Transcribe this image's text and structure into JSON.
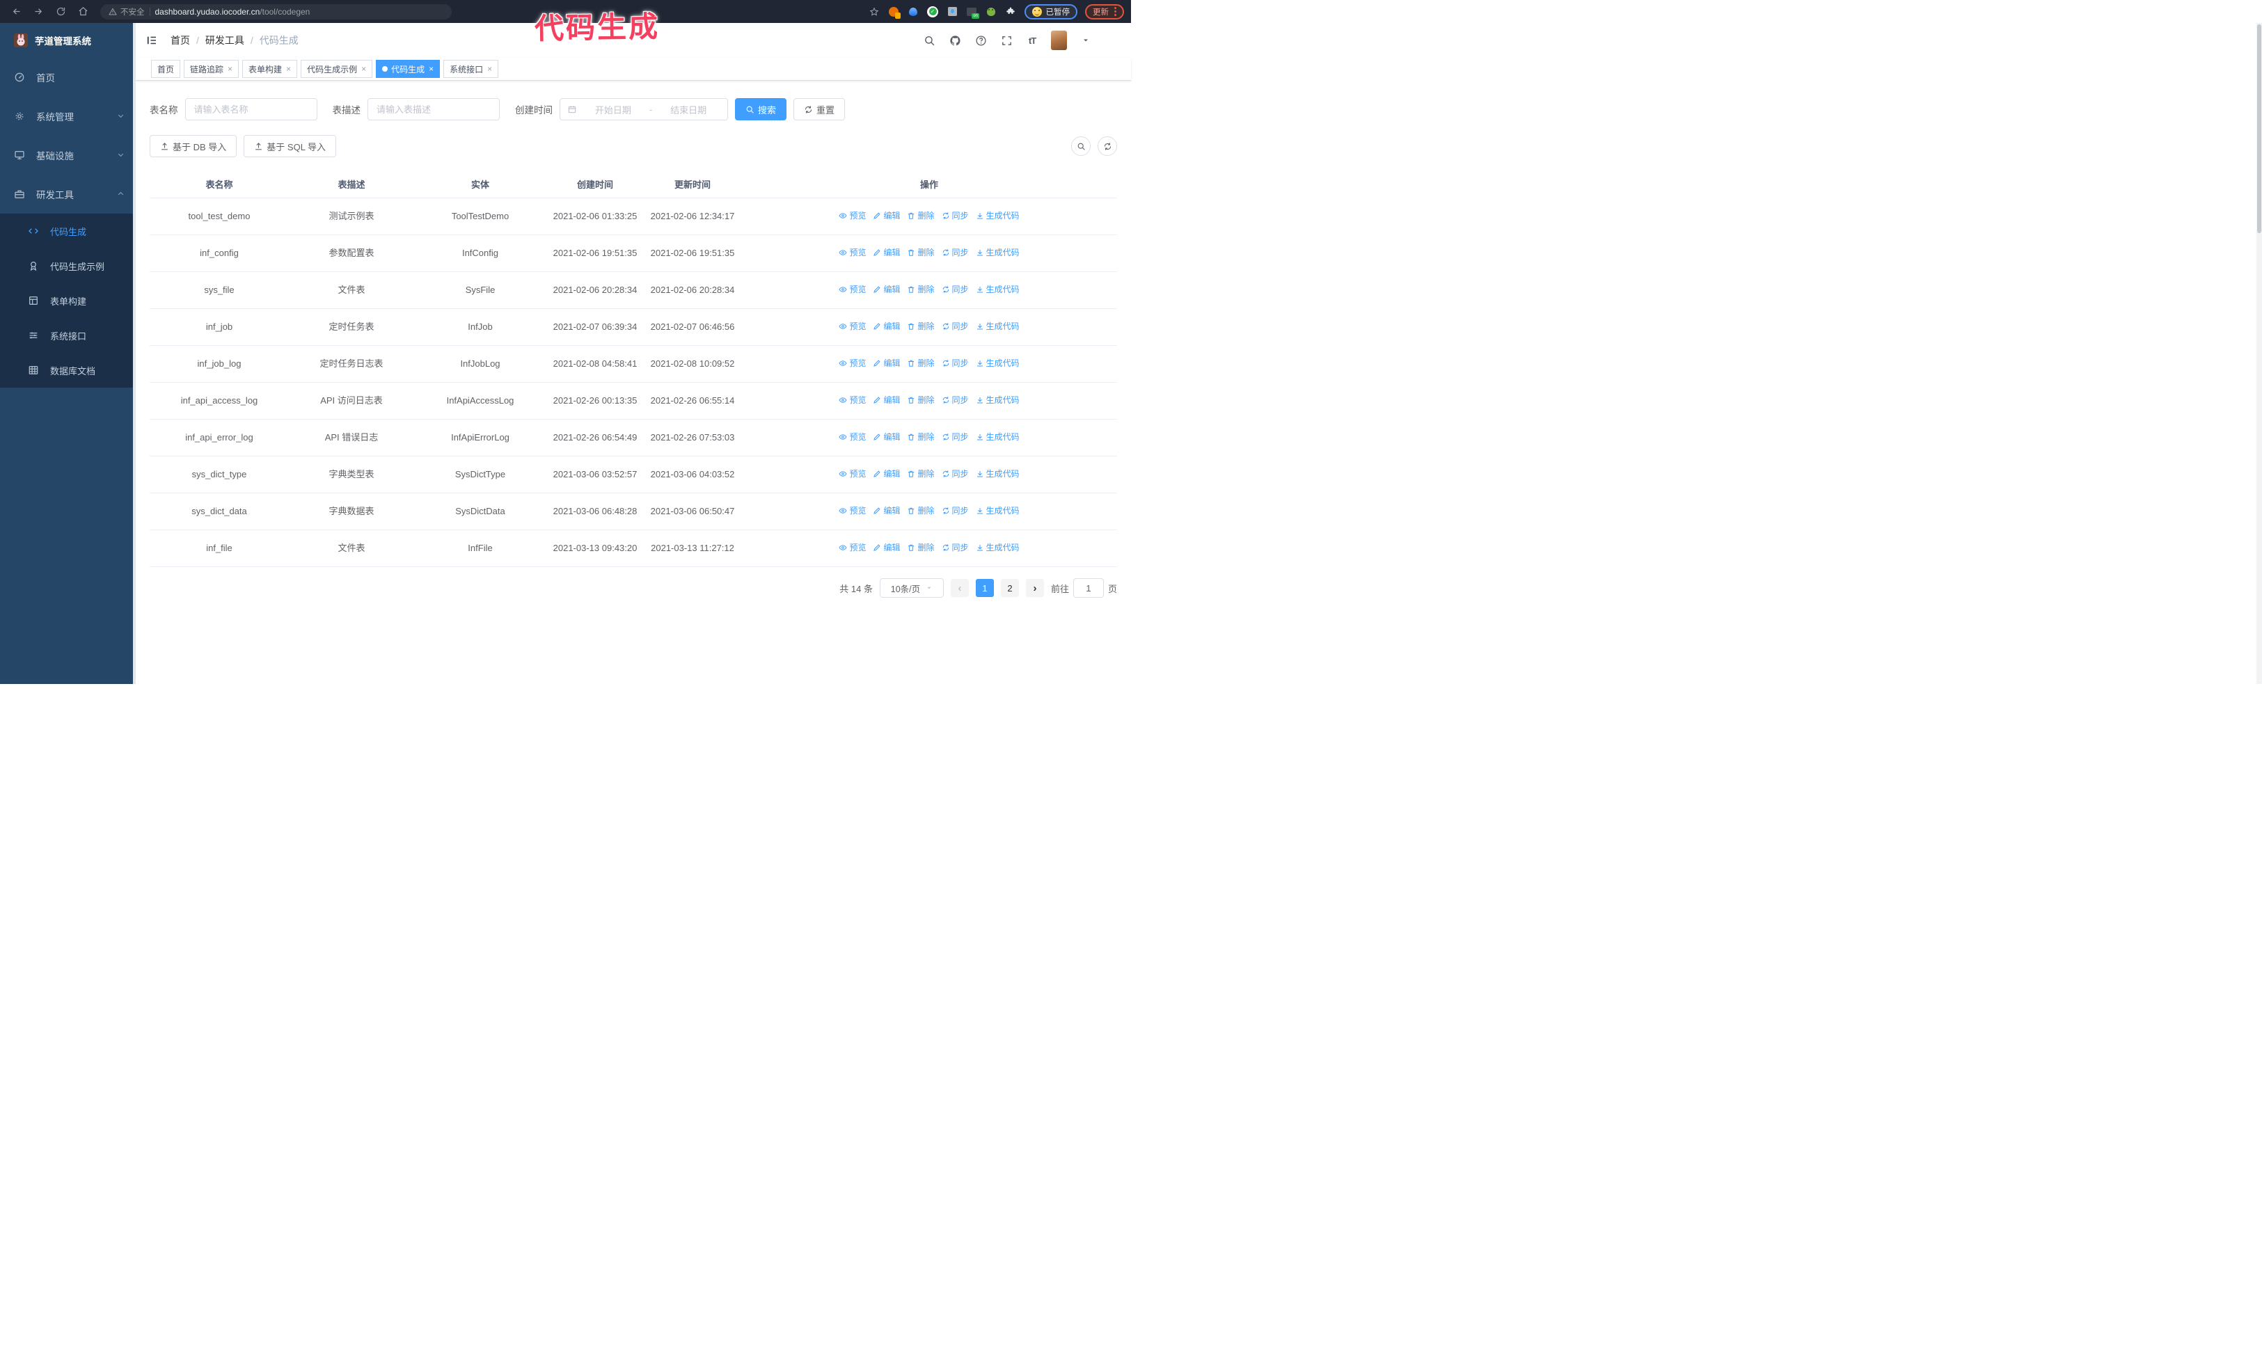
{
  "browser": {
    "security_label": "不安全",
    "url_host": "dashboard.yudao.iocoder.cn",
    "url_path": "/tool/codegen",
    "profile_status": "已暂停",
    "update_label": "更新"
  },
  "annotation": {
    "text": "代码生成",
    "color": "#f43f5e"
  },
  "sidebar": {
    "logo_title": "芋道管理系统",
    "items": [
      {
        "label": "首页",
        "icon": "dashboard-icon",
        "expandable": false,
        "expanded": false
      },
      {
        "label": "系统管理",
        "icon": "gear-icon",
        "expandable": true,
        "expanded": false
      },
      {
        "label": "基础设施",
        "icon": "monitor-icon",
        "expandable": true,
        "expanded": false
      },
      {
        "label": "研发工具",
        "icon": "toolbox-icon",
        "expandable": true,
        "expanded": true
      }
    ],
    "submenu": [
      {
        "label": "代码生成",
        "icon": "code-icon",
        "active": true
      },
      {
        "label": "代码生成示例",
        "icon": "medal-icon",
        "active": false
      },
      {
        "label": "表单构建",
        "icon": "form-icon",
        "active": false
      },
      {
        "label": "系统接口",
        "icon": "api-icon",
        "active": false
      },
      {
        "label": "数据库文档",
        "icon": "database-icon",
        "active": false
      }
    ]
  },
  "header": {
    "breadcrumb": [
      "首页",
      "研发工具",
      "代码生成"
    ]
  },
  "tabs": [
    {
      "label": "首页",
      "closable": false,
      "active": false
    },
    {
      "label": "链路追踪",
      "closable": true,
      "active": false
    },
    {
      "label": "表单构建",
      "closable": true,
      "active": false
    },
    {
      "label": "代码生成示例",
      "closable": true,
      "active": false
    },
    {
      "label": "代码生成",
      "closable": true,
      "active": true
    },
    {
      "label": "系统接口",
      "closable": true,
      "active": false
    }
  ],
  "search": {
    "name_label": "表名称",
    "name_placeholder": "请输入表名称",
    "desc_label": "表描述",
    "desc_placeholder": "请输入表描述",
    "time_label": "创建时间",
    "start_placeholder": "开始日期",
    "range_separator": "-",
    "end_placeholder": "结束日期",
    "search_button": "搜索",
    "reset_button": "重置"
  },
  "toolbar": {
    "db_import": "基于 DB 导入",
    "sql_import": "基于 SQL 导入"
  },
  "table": {
    "columns": [
      "表名称",
      "表描述",
      "实体",
      "创建时间",
      "更新时间",
      "操作"
    ],
    "actions": [
      "预览",
      "编辑",
      "删除",
      "同步",
      "生成代码"
    ],
    "rows": [
      [
        "tool_test_demo",
        "测试示例表",
        "ToolTestDemo",
        "2021-02-06 01:33:25",
        "2021-02-06 12:34:17"
      ],
      [
        "inf_config",
        "参数配置表",
        "InfConfig",
        "2021-02-06 19:51:35",
        "2021-02-06 19:51:35"
      ],
      [
        "sys_file",
        "文件表",
        "SysFile",
        "2021-02-06 20:28:34",
        "2021-02-06 20:28:34"
      ],
      [
        "inf_job",
        "定时任务表",
        "InfJob",
        "2021-02-07 06:39:34",
        "2021-02-07 06:46:56"
      ],
      [
        "inf_job_log",
        "定时任务日志表",
        "InfJobLog",
        "2021-02-08 04:58:41",
        "2021-02-08 10:09:52"
      ],
      [
        "inf_api_access_log",
        "API 访问日志表",
        "InfApiAccessLog",
        "2021-02-26 00:13:35",
        "2021-02-26 06:55:14"
      ],
      [
        "inf_api_error_log",
        "API 错误日志",
        "InfApiErrorLog",
        "2021-02-26 06:54:49",
        "2021-02-26 07:53:03"
      ],
      [
        "sys_dict_type",
        "字典类型表",
        "SysDictType",
        "2021-03-06 03:52:57",
        "2021-03-06 04:03:52"
      ],
      [
        "sys_dict_data",
        "字典数据表",
        "SysDictData",
        "2021-03-06 06:48:28",
        "2021-03-06 06:50:47"
      ],
      [
        "inf_file",
        "文件表",
        "InfFile",
        "2021-03-13 09:43:20",
        "2021-03-13 11:27:12"
      ]
    ]
  },
  "pagination": {
    "total_text": "共 14 条",
    "page_size": "10条/页",
    "prev": "‹",
    "next": "›",
    "pages": [
      "1",
      "2"
    ],
    "active_page": "1",
    "goto_label": "前往",
    "goto_value": "1",
    "goto_suffix": "页"
  },
  "colors": {
    "accent": "#409eff",
    "annotation": "#f43f5e",
    "sidebar_bg": "#254666",
    "submenu_bg": "#1b3048"
  }
}
